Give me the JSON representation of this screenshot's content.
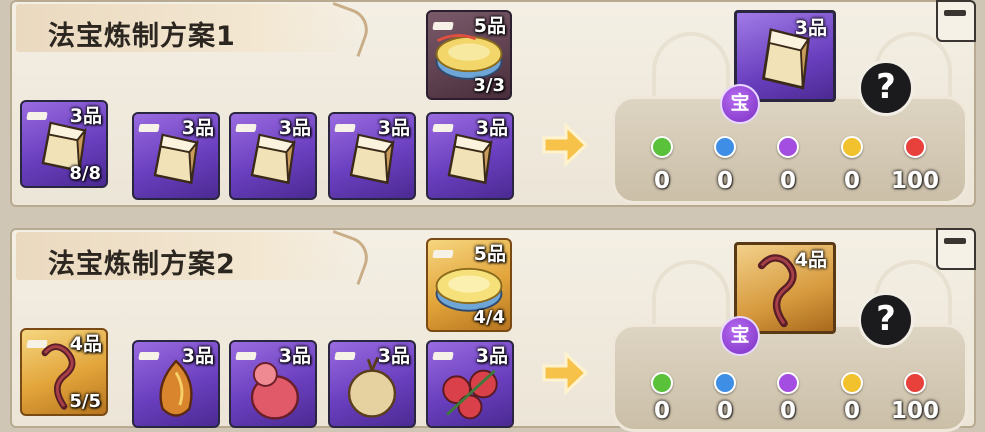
{
  "plans": [
    {
      "title": "法宝炼制方案1",
      "special_item": {
        "grade": "5品",
        "count": "3/3",
        "icon": "jade-disc-icon"
      },
      "materials": [
        {
          "grade": "3品",
          "count": "8/8",
          "icon": "crystal-ore-icon"
        },
        {
          "grade": "3品",
          "count": "",
          "icon": "crystal-ore-icon"
        },
        {
          "grade": "3品",
          "count": "",
          "icon": "crystal-ore-icon"
        },
        {
          "grade": "3品",
          "count": "",
          "icon": "crystal-ore-icon"
        },
        {
          "grade": "3品",
          "count": "",
          "icon": "crystal-ore-icon"
        }
      ],
      "result": {
        "grade": "3品",
        "badge": "宝",
        "icon": "crystal-ore-icon"
      },
      "help_label": "?",
      "odds": [
        {
          "color": "#59c23a",
          "value": "0"
        },
        {
          "color": "#3e8ee6",
          "value": "0"
        },
        {
          "color": "#a34ee0",
          "value": "0"
        },
        {
          "color": "#f2c12e",
          "value": "0"
        },
        {
          "color": "#e8403a",
          "value": "100"
        }
      ]
    },
    {
      "title": "法宝炼制方案2",
      "special_item": {
        "grade": "5品",
        "count": "4/4",
        "icon": "jade-disc-icon"
      },
      "materials": [
        {
          "grade": "4品",
          "count": "5/5",
          "icon": "thorn-vine-icon"
        },
        {
          "grade": "3品",
          "count": "",
          "icon": "flame-leaf-icon"
        },
        {
          "grade": "3品",
          "count": "",
          "icon": "peach-gourd-icon"
        },
        {
          "grade": "3品",
          "count": "",
          "icon": "spiky-seed-icon"
        },
        {
          "grade": "3品",
          "count": "",
          "icon": "red-flower-icon"
        }
      ],
      "result": {
        "grade": "4品",
        "badge": "宝",
        "icon": "thorn-vine-icon"
      },
      "help_label": "?",
      "odds": [
        {
          "color": "#59c23a",
          "value": "0"
        },
        {
          "color": "#3e8ee6",
          "value": "0"
        },
        {
          "color": "#a34ee0",
          "value": "0"
        },
        {
          "color": "#f2c12e",
          "value": "0"
        },
        {
          "color": "#e8403a",
          "value": "100"
        }
      ]
    }
  ]
}
